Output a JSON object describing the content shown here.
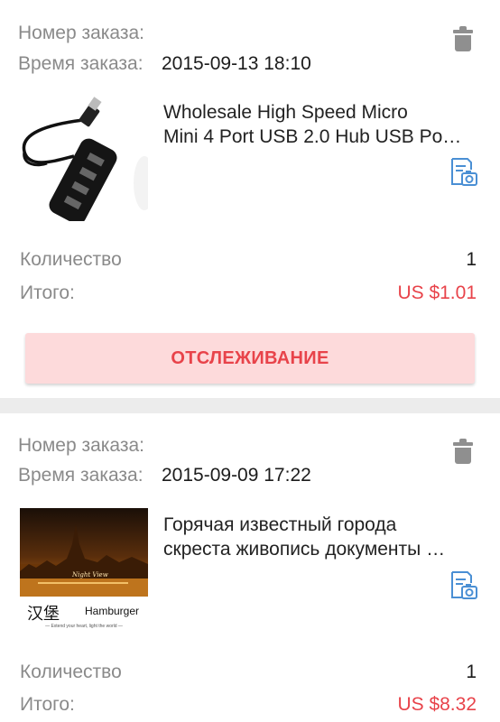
{
  "orders": [
    {
      "order_number_label": "Номер заказа:",
      "order_number": "",
      "order_time_label": "Время заказа:",
      "order_time": "2015-09-13 18:10",
      "product_line1": "Wholesale High Speed Micro",
      "product_line2": "Mini 4 Port USB 2.0 Hub USB Po…",
      "quantity_label": "Количество",
      "quantity": "1",
      "total_label": "Итого:",
      "total": "US $1.01",
      "track_label": "ОТСЛЕЖИВАНИЕ"
    },
    {
      "order_number_label": "Номер заказа:",
      "order_number": "",
      "order_time_label": "Время заказа:",
      "order_time": "2015-09-09 17:22",
      "product_line1": "Горячая известный города",
      "product_line2": "скреста живопись документы …",
      "image_text_cn": "汉堡",
      "image_text_city": "Hamburger",
      "image_script": "Night View",
      "image_tagline": "— Extend your heart, light the world —",
      "quantity_label": "Количество",
      "quantity": "1",
      "total_label": "Итого:",
      "total": "US $8.32"
    }
  ],
  "colors": {
    "price_red": "#e8434a",
    "track_button_bg": "#fddadb",
    "icon_blue": "#4a8fd4",
    "icon_gray": "#8f8f8f"
  },
  "icons": [
    "trash-icon",
    "snapshot-icon"
  ]
}
